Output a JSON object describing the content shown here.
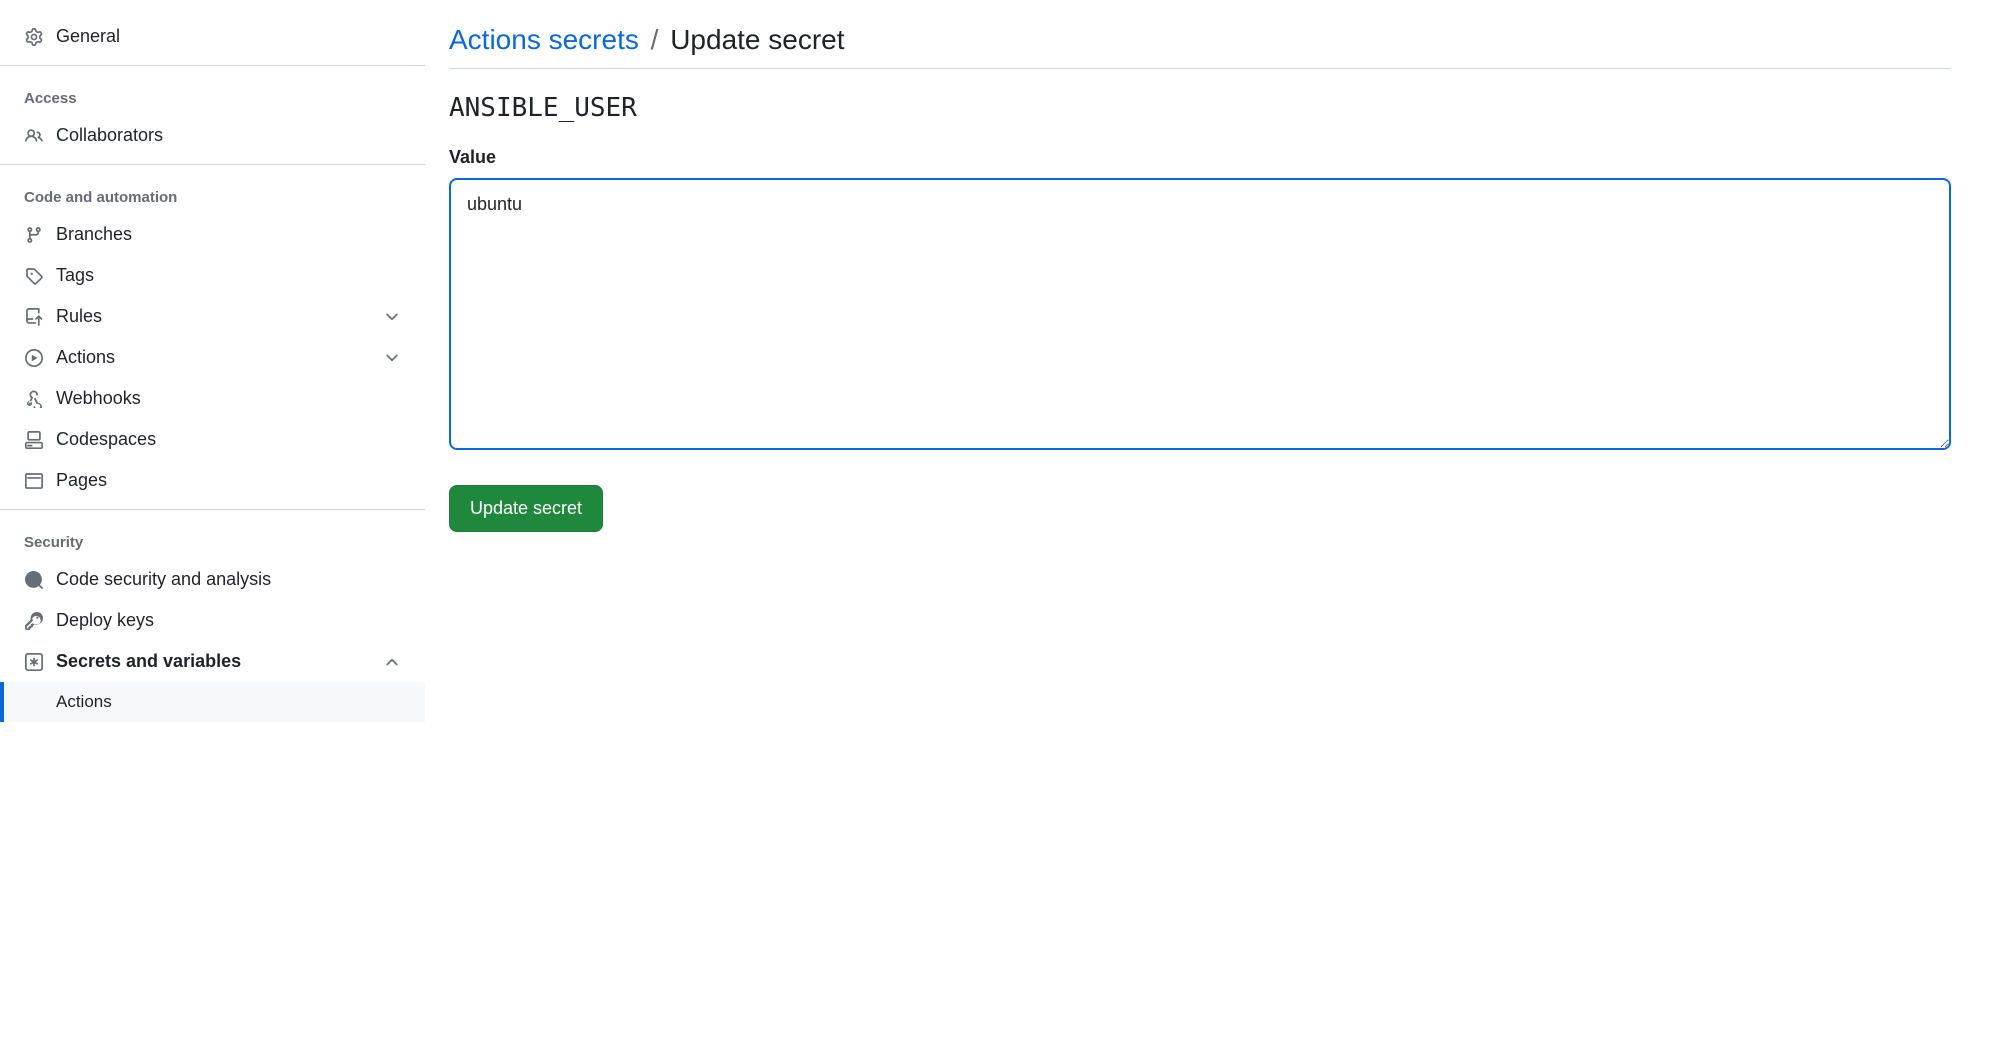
{
  "sidebar": {
    "general": "General",
    "sections": {
      "access": {
        "title": "Access",
        "collaborators": "Collaborators"
      },
      "code": {
        "title": "Code and automation",
        "branches": "Branches",
        "tags": "Tags",
        "rules": "Rules",
        "actions": "Actions",
        "webhooks": "Webhooks",
        "codespaces": "Codespaces",
        "pages": "Pages"
      },
      "security": {
        "title": "Security",
        "code_security": "Code security and analysis",
        "deploy_keys": "Deploy keys",
        "secrets_vars": "Secrets and variables",
        "secrets_actions": "Actions"
      }
    }
  },
  "main": {
    "breadcrumb_link": "Actions secrets",
    "breadcrumb_sep": "/",
    "breadcrumb_current": "Update secret",
    "secret_name": "ANSIBLE_USER",
    "value_label": "Value",
    "value_content": "ubuntu",
    "button_label": "Update secret"
  }
}
